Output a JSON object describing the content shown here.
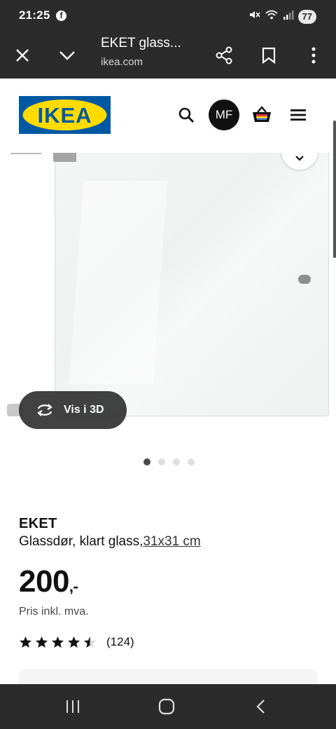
{
  "status_bar": {
    "time": "21:25",
    "battery": "77",
    "icons": [
      "facebook-icon",
      "mute-icon",
      "wifi-icon",
      "signal-icon",
      "battery-icon"
    ]
  },
  "browser": {
    "page_title": "EKET glass...",
    "domain": "ikea.com",
    "icons": [
      "close-icon",
      "chevron-down-icon",
      "share-icon",
      "bookmark-icon",
      "more-vert-icon"
    ]
  },
  "header": {
    "logo_text": "IKEA",
    "avatar_initials": "MF",
    "icons": [
      "search-icon",
      "shopping-basket-icon",
      "hamburger-menu-icon"
    ],
    "brand_blue": "#0058a3",
    "brand_yellow": "#ffdb00"
  },
  "gallery": {
    "view_3d_label": "Vis i 3D",
    "slide_count": 4,
    "active_slide": 1
  },
  "product": {
    "name": "EKET",
    "description": "Glassdør, klart glass,",
    "size": "31x31 cm",
    "price": "200",
    "price_suffix": ",-",
    "price_note": "Pris inkl. mva.",
    "rating": 4.5,
    "rating_max": 5,
    "review_count": "(124)"
  }
}
